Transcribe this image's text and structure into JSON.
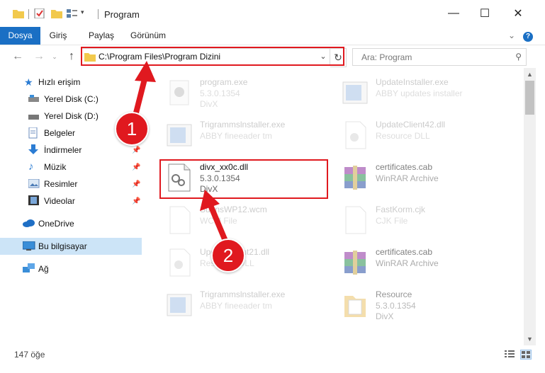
{
  "window": {
    "title": "Program",
    "minimize_glyph": "—",
    "maximize_glyph": "☐",
    "close_glyph": "✕"
  },
  "ribbon": {
    "tabs": [
      "Dosya",
      "Giriş",
      "Paylaş",
      "Görünüm"
    ],
    "expand_glyph": "⌄",
    "help_glyph": "?"
  },
  "address": {
    "path": "C:\\Program Files\\Program Dizini",
    "search_placeholder": "Ara: Program"
  },
  "sidebar": {
    "items": [
      {
        "label": "Hızlı erişim",
        "icon": "star-icon"
      },
      {
        "label": "Yerel Disk (C:)",
        "icon": "drive-icon"
      },
      {
        "label": "Yerel Disk (D:)",
        "icon": "drive-icon"
      },
      {
        "label": "Belgeler",
        "icon": "documents-icon"
      },
      {
        "label": "İndirmeler",
        "icon": "download-icon"
      },
      {
        "label": "Müzik",
        "icon": "music-icon"
      },
      {
        "label": "Resimler",
        "icon": "pictures-icon"
      },
      {
        "label": "Videolar",
        "icon": "video-icon"
      },
      {
        "label": "OneDrive",
        "icon": "cloud-icon"
      },
      {
        "label": "Bu bilgisayar",
        "icon": "computer-icon"
      },
      {
        "label": "Ağ",
        "icon": "network-icon"
      }
    ]
  },
  "files": [
    {
      "name": "program.exe",
      "line2": "5.3.0.1354",
      "line3": "DivX",
      "icon": "exe-icon"
    },
    {
      "name": "UpdateInstaller.exe",
      "line2": "ABBY updates installer",
      "line3": "",
      "icon": "installer-icon"
    },
    {
      "name": "Trigrammslnstaller.exe",
      "line2": "ABBY fineeader tm",
      "line3": "",
      "icon": "installer-icon"
    },
    {
      "name": "UpdateClient42.dll",
      "line2": "Resource DLL",
      "line3": "",
      "icon": "dll-icon"
    },
    {
      "name": "divx_xx0c.dll",
      "line2": "5.3.0.1354",
      "line3": "DivX",
      "icon": "dll-icon"
    },
    {
      "name": "certificates.cab",
      "line2": "WinRAR Archive",
      "line3": "",
      "icon": "archive-icon"
    },
    {
      "name": "SubnsWP12.wcm",
      "line2": "WCM File",
      "line3": "",
      "icon": "file-icon"
    },
    {
      "name": "FastKorm.cjk",
      "line2": "CJK File",
      "line3": "",
      "icon": "file-icon"
    },
    {
      "name": "UpdateClient21.dll",
      "line2": "Resource DLL",
      "line3": "",
      "icon": "dll-icon"
    },
    {
      "name": "certificates.cab",
      "line2": "WinRAR Archive",
      "line3": "",
      "icon": "archive-icon"
    },
    {
      "name": "Trigrammslnstaller.exe",
      "line2": "ABBY fineeader tm",
      "line3": "",
      "icon": "installer-icon"
    },
    {
      "name": "Resource",
      "line2": "5.3.0.1354",
      "line3": "DivX",
      "icon": "folder-icon"
    }
  ],
  "status": {
    "item_count": "147 öğe"
  },
  "callouts": {
    "one": "1",
    "two": "2"
  },
  "colors": {
    "accent": "#1a6fc4",
    "highlight_red": "#e0191f",
    "selection": "#cce4f7"
  }
}
